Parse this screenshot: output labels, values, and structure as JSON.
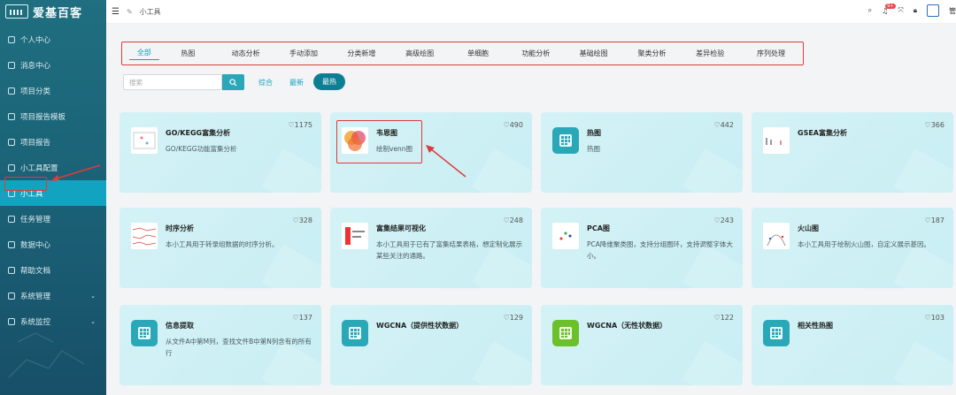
{
  "sidebar": {
    "logo_text": "爱基百客",
    "items": [
      {
        "label": "个人中心"
      },
      {
        "label": "消息中心"
      },
      {
        "label": "项目分类"
      },
      {
        "label": "项目报告模板"
      },
      {
        "label": "项目报告"
      },
      {
        "label": "小工具配置"
      },
      {
        "label": "小工具",
        "active": true
      },
      {
        "label": "任务管理"
      },
      {
        "label": "数据中心"
      },
      {
        "label": "帮助文档"
      },
      {
        "label": "系统管理",
        "chevron": "⌄"
      },
      {
        "label": "系统监控",
        "chevron": "⌄"
      }
    ]
  },
  "topbar": {
    "breadcrumb": "小工具",
    "notification_count": "9+",
    "user": "管"
  },
  "tabs": [
    "全部",
    "热图",
    "动态分析",
    "手动添加",
    "分类新增",
    "高级绘图",
    "单细胞",
    "功能分析",
    "基础绘图",
    "聚类分析",
    "差异检验",
    "序列处理"
  ],
  "search": {
    "placeholder": "搜索"
  },
  "filters": {
    "comprehensive": "综合",
    "latest": "最新",
    "hottest": "最热"
  },
  "cards": [
    {
      "title": "GO/KEGG富集分析",
      "desc": "GO/KEGG功能富集分析",
      "likes": "1175",
      "icon": "go-kegg-thumb"
    },
    {
      "title": "韦恩图",
      "desc": "绘制venn图",
      "likes": "490",
      "icon": "venn-thumb"
    },
    {
      "title": "热图",
      "desc": "热图",
      "likes": "442",
      "icon": "grid-icon"
    },
    {
      "title": "GSEA富集分析",
      "desc": "",
      "likes": "366",
      "icon": "gsea-thumb"
    },
    {
      "title": "时序分析",
      "desc": "本小工具用于转录组数据的时序分析。",
      "likes": "328",
      "icon": "timeseries-thumb"
    },
    {
      "title": "富集结果可视化",
      "desc": "本小工具用于已有了富集结果表格，想定制化展示某些关注的通路。",
      "likes": "248",
      "icon": "enrich-thumb"
    },
    {
      "title": "PCA图",
      "desc": "PCA降维聚类图，支持分组圈环，支持调整字体大小。",
      "likes": "243",
      "icon": "pca-thumb"
    },
    {
      "title": "火山图",
      "desc": "本小工具用于绘制火山图，自定义展示基因。",
      "likes": "187",
      "icon": "volcano-thumb"
    },
    {
      "title": "信息提取",
      "desc": "从文件A中第M列，查找文件B中第N列含有的所有行",
      "likes": "137",
      "icon": "grid-icon"
    },
    {
      "title": "WGCNA（提供性状数据）",
      "desc": "",
      "likes": "129",
      "icon": "grid-icon"
    },
    {
      "title": "WGCNA（无性状数据）",
      "desc": "",
      "likes": "122",
      "icon": "grid-icon-green"
    },
    {
      "title": "相关性热图",
      "desc": "",
      "likes": "103",
      "icon": "grid-icon"
    }
  ],
  "colors": {
    "accent": "#14a0bd",
    "sidebar": "#1a5e74",
    "highlight": "#e03a3a",
    "green": "#6cc02a"
  }
}
